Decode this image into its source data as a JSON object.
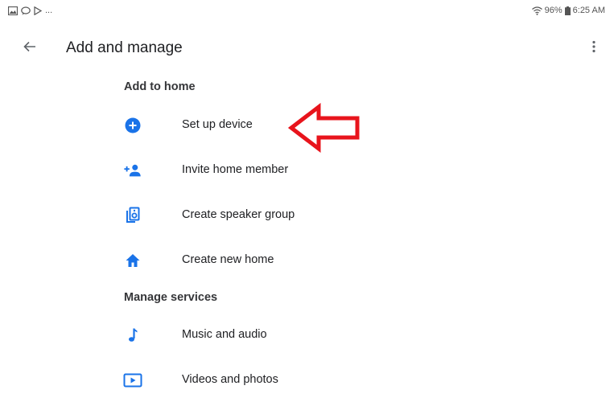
{
  "status_bar": {
    "left_ellipsis": "...",
    "battery_percent": "96%",
    "time": "6:25 AM",
    "icons_left": [
      "gallery-icon",
      "chat-icon",
      "play-store-icon"
    ],
    "icons_right": [
      "wifi-icon",
      "battery-icon"
    ]
  },
  "app_bar": {
    "title": "Add and manage",
    "back_icon": "arrow-back-icon",
    "overflow_icon": "more-vert-icon"
  },
  "sections": [
    {
      "header": "Add to home",
      "items": [
        {
          "label": "Set up device",
          "icon": "add-circle-icon"
        },
        {
          "label": "Invite home member",
          "icon": "person-add-icon"
        },
        {
          "label": "Create speaker group",
          "icon": "speaker-group-icon"
        },
        {
          "label": "Create new home",
          "icon": "home-icon"
        }
      ]
    },
    {
      "header": "Manage services",
      "items": [
        {
          "label": "Music and audio",
          "icon": "music-note-icon"
        },
        {
          "label": "Videos and photos",
          "icon": "video-icon"
        }
      ]
    }
  ],
  "colors": {
    "accent": "#1a73e8",
    "annotation": "#e8141c",
    "text": "#202124"
  }
}
